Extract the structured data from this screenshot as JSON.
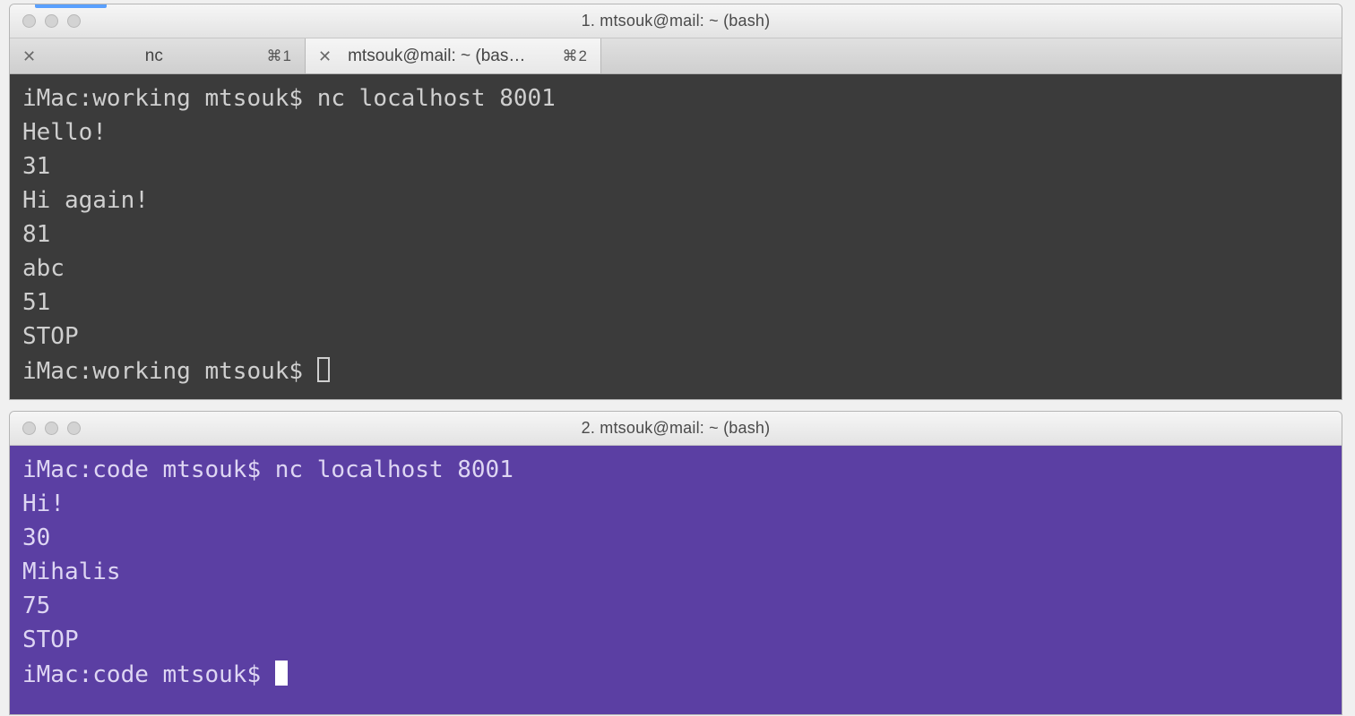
{
  "window1": {
    "title": "1. mtsouk@mail: ~ (bash)",
    "tabs": [
      {
        "label": "nc",
        "shortcut": "⌘1",
        "active": false
      },
      {
        "label": "mtsouk@mail: ~ (bas…",
        "shortcut": "⌘2",
        "active": true
      }
    ],
    "lines": [
      "iMac:working mtsouk$ nc localhost 8001",
      "Hello!",
      "31",
      "Hi again!",
      "81",
      "abc",
      "51",
      "STOP"
    ],
    "prompt": "iMac:working mtsouk$ "
  },
  "window2": {
    "title": "2. mtsouk@mail: ~ (bash)",
    "lines": [
      "iMac:code mtsouk$ nc localhost 8001",
      "Hi!",
      "30",
      "Mihalis",
      "75",
      "STOP"
    ],
    "prompt": "iMac:code mtsouk$ "
  }
}
